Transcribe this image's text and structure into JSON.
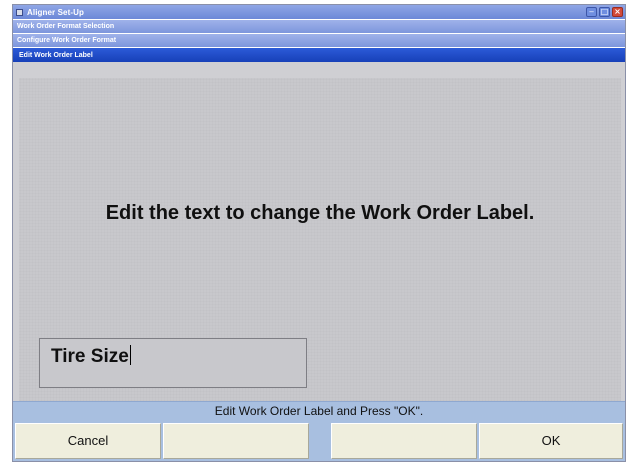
{
  "window": {
    "title": "Aligner Set-Up",
    "breadcrumbs": [
      "Work Order Format Selection",
      "Configure Work Order Format"
    ],
    "active_panel_title": "Edit Work Order Label"
  },
  "main": {
    "instruction": "Edit the text to change the Work Order Label.",
    "label_field": {
      "value": "Tire Size"
    }
  },
  "status": {
    "message": "Edit Work Order Label and Press \"OK\"."
  },
  "softkeys": [
    {
      "label": "Cancel"
    },
    {
      "label": ""
    },
    {
      "label": ""
    },
    {
      "label": "OK"
    }
  ],
  "colors": {
    "title_bar": "#7d96dc",
    "active_title_bar": "#1740b8",
    "content_bg": "#c8c8cc",
    "status_bar": "#a8bfe0",
    "softkey_bg": "#efeedd"
  },
  "icons": {
    "minimize": "minimize-icon",
    "maximize": "maximize-icon",
    "close": "close-icon",
    "app": "app-icon"
  }
}
